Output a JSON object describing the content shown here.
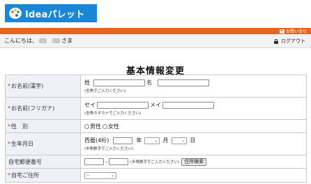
{
  "header": {
    "brand": "Ideaパレット",
    "contact_link": "お問い合せ",
    "greeting_prefix": "こんにちは、",
    "greeting_suffix": "さま",
    "logout": "ログアウト",
    "brand_color": "#1a86d6",
    "accent_color": "#e8641c"
  },
  "page": {
    "title": "基本情報変更"
  },
  "form": {
    "rows": {
      "name_kanji": {
        "label": "お名前(漢字)",
        "required": "*",
        "sei": "姓",
        "mei": "名",
        "note": "(全角でご入力ください)"
      },
      "name_kana": {
        "label": "お名前(フリガナ)",
        "required": "*",
        "sei": "セイ",
        "mei": "メイ",
        "note": "(全角カタカナでご入力ください)"
      },
      "gender": {
        "label": "性　別",
        "required": "*",
        "options": [
          "男性",
          "女性"
        ]
      },
      "birthday": {
        "label": "生年月日",
        "required": "*",
        "era": "西暦(4桁)",
        "year": "年",
        "month": "月",
        "day": "日",
        "note": "(半角数字でご入力ください)"
      },
      "postal": {
        "label": "自宅郵便番号",
        "required": "",
        "separator": "-",
        "note": "(半角数字でご入力ください)",
        "search_button": "住所検索"
      },
      "address": {
        "label": "自宅ご住所",
        "required": "*",
        "prefecture_selected": "--"
      }
    }
  }
}
